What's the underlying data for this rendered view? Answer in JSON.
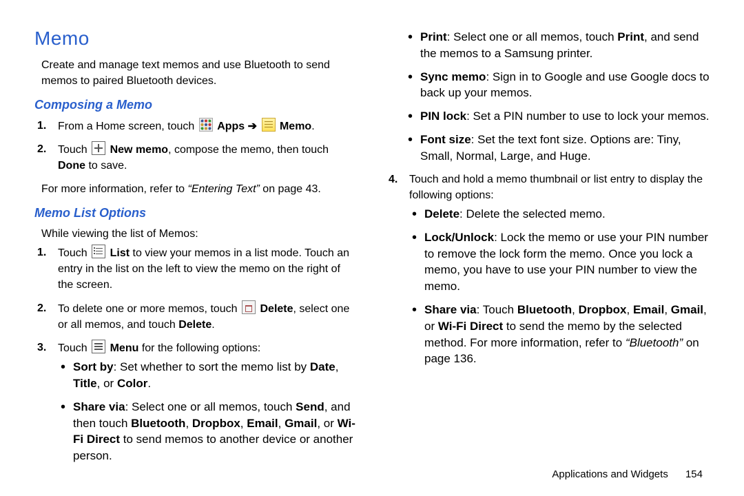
{
  "page": {
    "title": "Memo",
    "intro": "Create and manage text memos and use Bluetooth to send memos to paired Bluetooth devices.",
    "footer_section": "Applications and Widgets",
    "footer_page": "154"
  },
  "composing": {
    "heading": "Composing a Memo",
    "step1_pre": "From a Home screen, touch ",
    "step1_apps": "Apps",
    "step1_arrow": " ➔ ",
    "step1_memo": "Memo",
    "step1_post": ".",
    "step2_pre": "Touch ",
    "step2_newmemo": "New memo",
    "step2_mid": ", compose the memo, then touch ",
    "step2_done": "Done",
    "step2_post": " to save.",
    "ref_pre": "For more information, refer to ",
    "ref_quote": "“Entering Text”",
    "ref_post": " on page 43."
  },
  "listopts": {
    "heading": "Memo List Options",
    "intro": "While viewing the list of Memos:",
    "s1_pre": "Touch ",
    "s1_list": "List",
    "s1_post": " to view your memos in a list mode. Touch an entry in the list on the left to view the memo on the right of the screen.",
    "s2_pre": "To delete one or more memos, touch ",
    "s2_delete": "Delete",
    "s2_mid": ", select one or all memos, and touch ",
    "s2_delete2": "Delete",
    "s2_post": ".",
    "s3_pre": "Touch ",
    "s3_menu": "Menu",
    "s3_post": " for the following options:",
    "sortby_label": "Sort by",
    "sortby_text": ": Set whether to sort the memo list by ",
    "sortby_date": "Date",
    "sortby_sep1": ", ",
    "sortby_title": "Title",
    "sortby_sep2": ", or ",
    "sortby_color": "Color",
    "sortby_end": ".",
    "sharevia_label": "Share via",
    "sharevia_text": ": Select one or all memos, touch ",
    "sharevia_send": "Send",
    "sharevia_mid": ", and then touch ",
    "sharevia_bt": "Bluetooth",
    "sep_comma": ", ",
    "sharevia_db": "Dropbox",
    "sharevia_em": "Email",
    "sharevia_gm": "Gmail",
    "sep_or": ", or ",
    "sharevia_wf": "Wi-Fi Direct",
    "sharevia_end": " to send memos to another device or another person."
  },
  "rightcol": {
    "print_label": "Print",
    "print_text": ": Select one or all memos, touch ",
    "print_b": "Print",
    "print_end": ", and send the memos to a Samsung printer.",
    "sync_label": "Sync memo",
    "sync_text": ": Sign in to Google and use Google docs to back up your memos.",
    "pin_label": "PIN lock",
    "pin_text": ": Set a PIN number to use to lock your memos.",
    "font_label": "Font size",
    "font_text": ": Set the text font size. Options are: Tiny, Small, Normal, Large, and Huge.",
    "step4": "Touch and hold a memo thumbnail or list entry to display the following options:",
    "del_label": "Delete",
    "del_text": ": Delete the selected memo.",
    "lock_label": "Lock/Unlock",
    "lock_text": ": Lock the memo or use your PIN number to remove the lock form the memo. Once you lock a memo, you have to use your PIN number to view the memo.",
    "share2_label": "Share via",
    "share2_pre": ": Touch ",
    "share2_bt": "Bluetooth",
    "share2_db": "Dropbox",
    "share2_em": "Email",
    "share2_gm": "Gmail",
    "share2_wf": "Wi-Fi Direct",
    "share2_mid": " to send the memo by the selected method. For more information, refer to ",
    "share2_quote": "“Bluetooth”",
    "share2_end": " on page 136."
  }
}
